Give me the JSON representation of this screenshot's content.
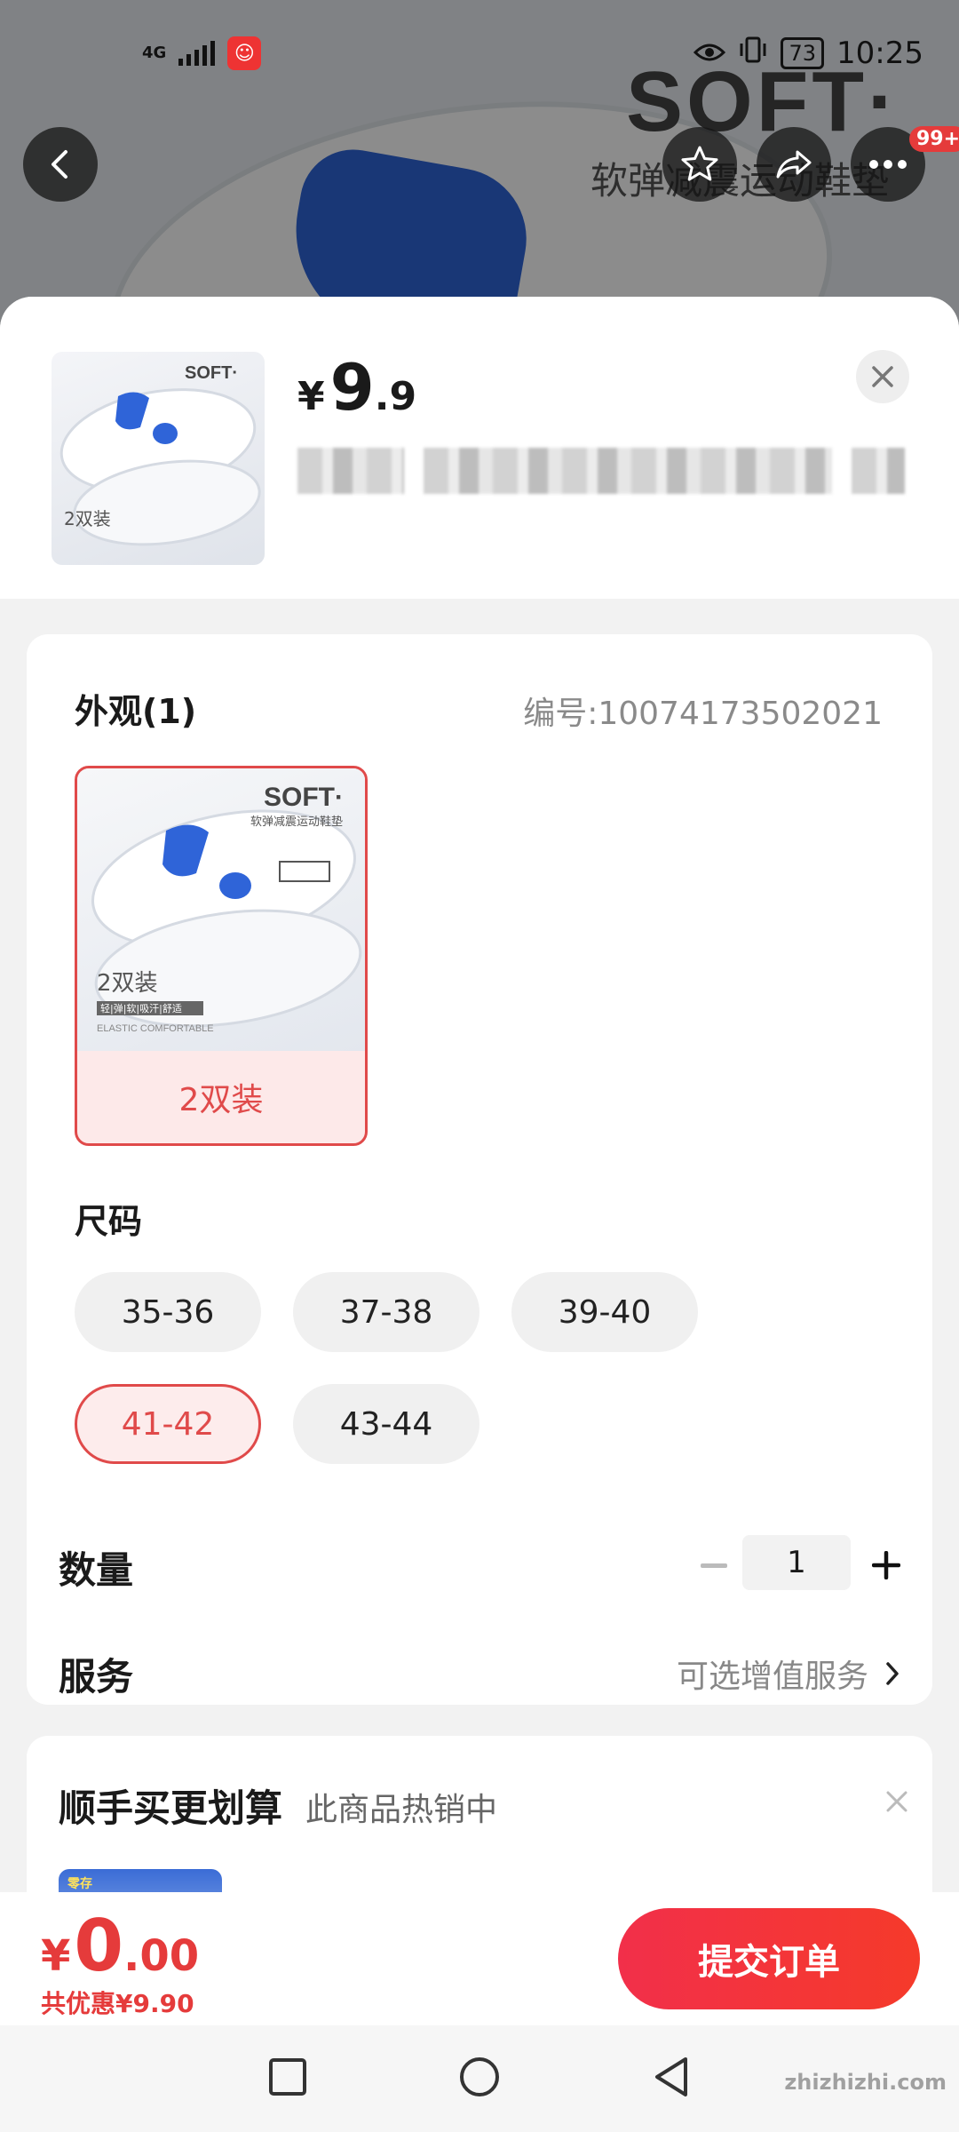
{
  "status_bar": {
    "network": "4G",
    "battery": "73",
    "time": "10:25"
  },
  "background": {
    "brand": "SOFT·",
    "subtitle": "软弹减震运动鞋垫"
  },
  "top_bar": {
    "badge": "99+"
  },
  "header": {
    "currency": "¥",
    "price_int": "9",
    "price_dec": ".9"
  },
  "spec": {
    "title": "外观(1)",
    "code": "编号:10074173502021",
    "variant": {
      "label": "2双装",
      "image_brand": "SOFT·",
      "image_sub": "软弹减震运动鞋垫",
      "image_text": "2双装",
      "image_tags": "轻|弹|软|吸汗|舒适",
      "image_en": "ELASTIC COMFORTABLE"
    },
    "size_title": "尺码",
    "sizes": [
      "35-36",
      "37-38",
      "39-40",
      "41-42",
      "43-44"
    ],
    "selected_size": "41-42"
  },
  "quantity": {
    "label": "数量",
    "value": "1"
  },
  "service": {
    "label": "服务",
    "value": "可选增值服务"
  },
  "deal": {
    "title": "顺手买更划算",
    "subtitle": "此商品热销中",
    "thumb_text": "零存"
  },
  "footer": {
    "currency": "¥",
    "price_int": "0",
    "price_dec": ".00",
    "discount": "共优惠¥9.90",
    "submit": "提交订单"
  },
  "watermark": "zhizhizhi.com",
  "colors": {
    "accent": "#e53b3b",
    "selected_bg": "#fdecec"
  }
}
